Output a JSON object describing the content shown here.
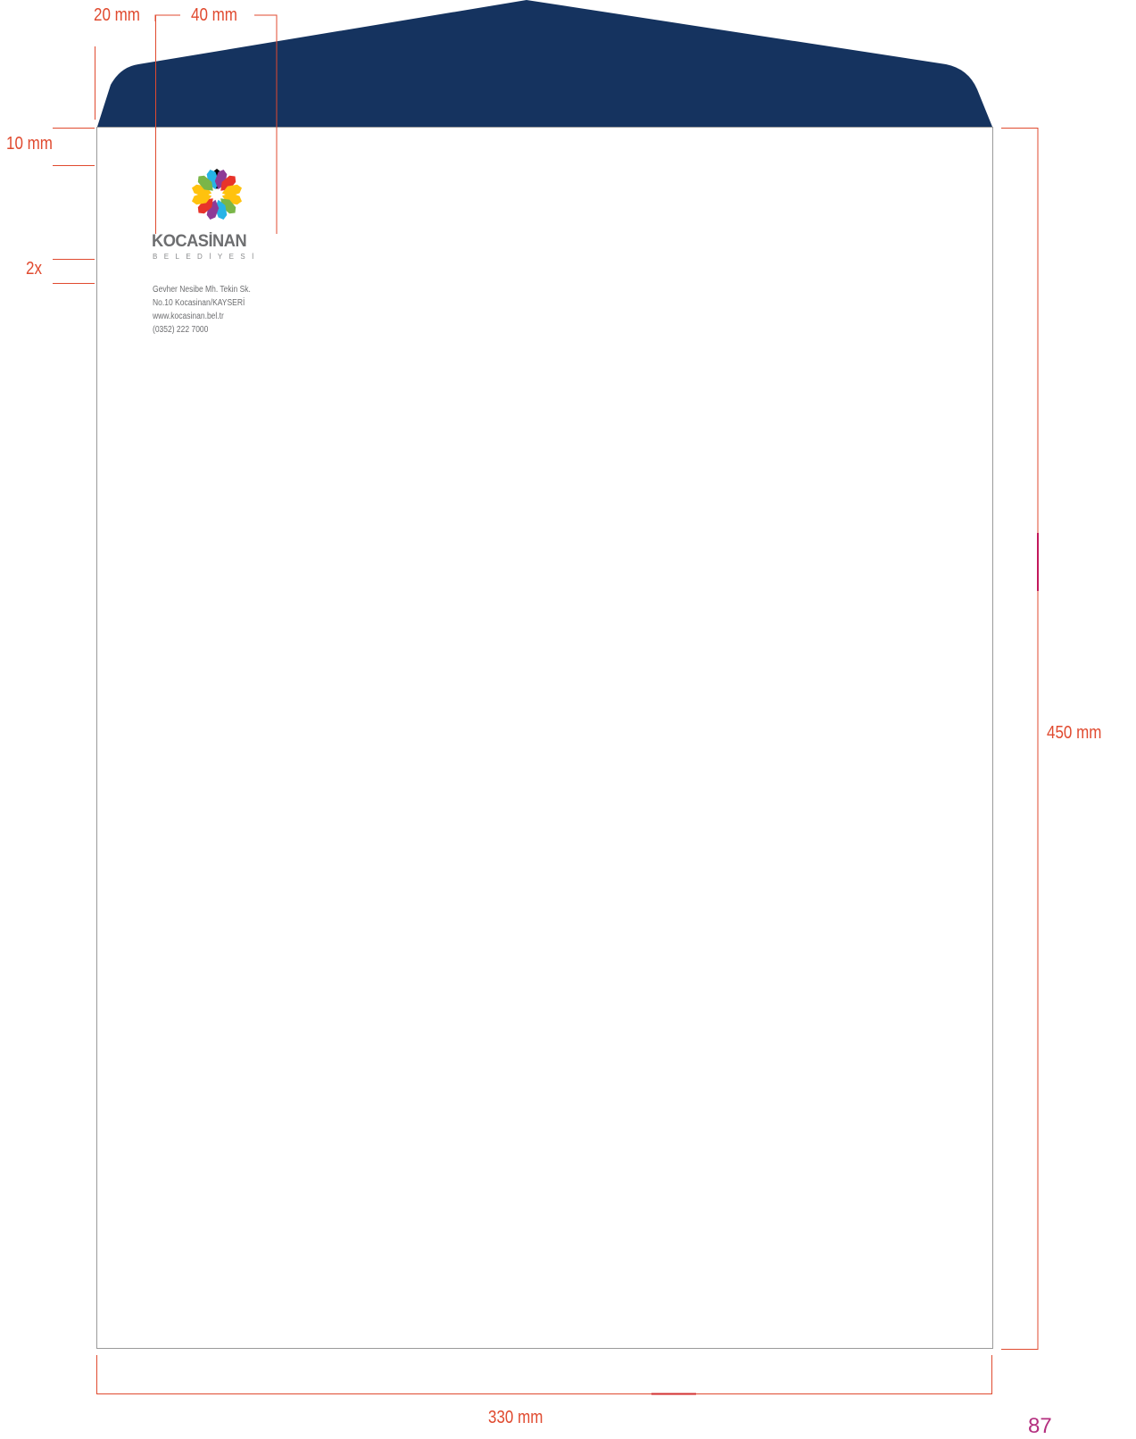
{
  "dimensions": {
    "left_margin": "20 mm",
    "logo_width": "40 mm",
    "top_margin": "10 mm",
    "spacing": "2x",
    "height": "450 mm",
    "width": "330 mm"
  },
  "logo": {
    "wordmark": "KOCASİNAN",
    "subline": "BELEDİYESİ"
  },
  "address": {
    "line1": "Gevher Nesibe Mh. Tekin Sk.",
    "line2": "No.10 Kocasinan/KAYSERİ",
    "line3": "www.kocasinan.bel.tr",
    "line4": "(0352) 222 7000"
  },
  "page_number": "87",
  "colors": {
    "flap": "#15335f",
    "dimension_lines": "#e04a2f",
    "envelope_border": "#9a9a9a"
  }
}
